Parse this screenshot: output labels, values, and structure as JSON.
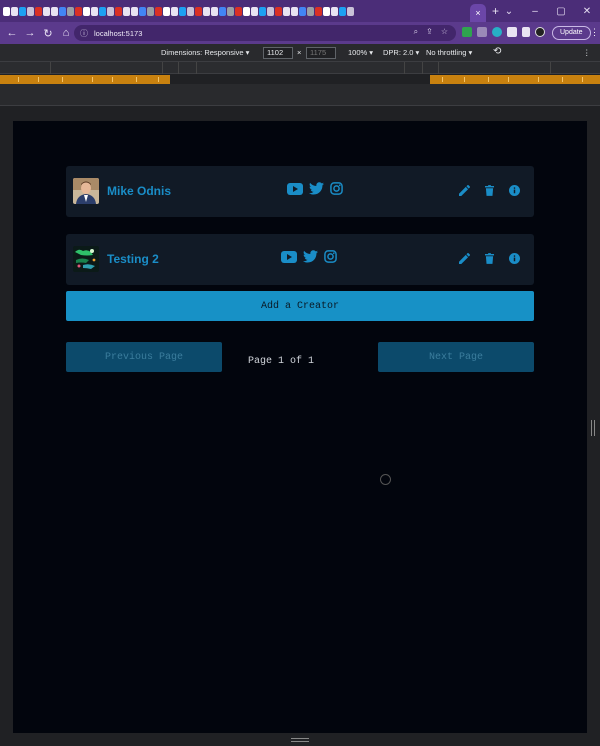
{
  "browser": {
    "url": "localhost:5173",
    "update_label": "Update",
    "active_tab_close": "×",
    "new_tab": "+",
    "window_controls": [
      "⌄",
      "–",
      "▢",
      "✕"
    ]
  },
  "devtools": {
    "dimensions_label": "Dimensions: Responsive",
    "width": "1102",
    "times": "×",
    "height": "1175",
    "zoom": "100%",
    "dpr": "DPR: 2.0",
    "throttling": "No throttling"
  },
  "creators": [
    {
      "name": "Mike Odnis",
      "socials": [
        "youtube-icon",
        "twitter-icon",
        "instagram-icon"
      ]
    },
    {
      "name": "Testing 2",
      "socials": [
        "youtube-icon",
        "twitter-icon",
        "instagram-icon"
      ]
    }
  ],
  "add_creator_label": "Add a Creator",
  "pagination": {
    "previous_label": "Previous Page",
    "next_label": "Next Page",
    "page_info": "Page 1 of 1"
  },
  "colors": {
    "accent": "#1791c6",
    "creator_name": "#1a8dc7",
    "card_bg": "#111a26",
    "page_bg": "#02050d",
    "disabled_btn": "#0c4a6b",
    "browser_tabbar": "#4b2d78",
    "browser_toolbar": "#5b3a8c"
  }
}
